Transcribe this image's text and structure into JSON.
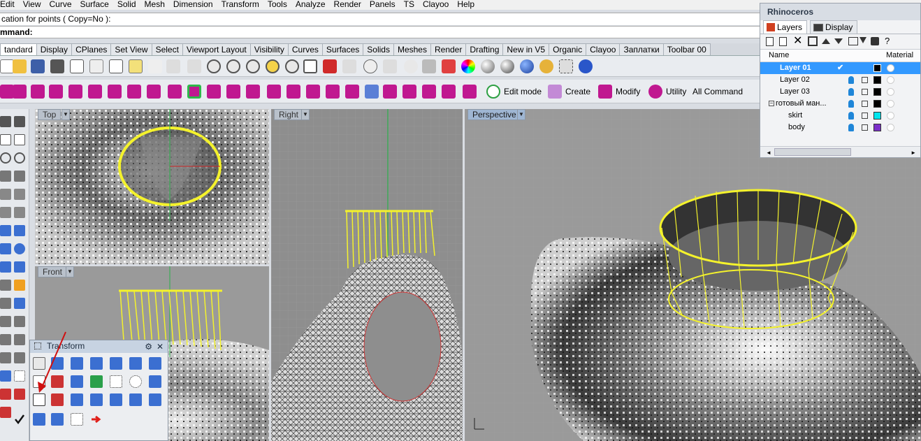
{
  "menubar": [
    "Edit",
    "View",
    "Curve",
    "Surface",
    "Solid",
    "Mesh",
    "Dimension",
    "Transform",
    "Tools",
    "Analyze",
    "Render",
    "Panels",
    "TS",
    "Clayoo",
    "Help"
  ],
  "command_history": "cation for points ( Copy=No ):",
  "command_prompt": "mmand:",
  "tabs": [
    "tandard",
    "Display",
    "CPlanes",
    "Set View",
    "Select",
    "Viewport Layout",
    "Visibility",
    "Curves",
    "Surfaces",
    "Solids",
    "Meshes",
    "Render",
    "Drafting",
    "New in V5",
    "Organic",
    "Clayoo",
    "Заплатки",
    "Toolbar 00"
  ],
  "toolbar2_labels": {
    "edit_mode": "Edit mode",
    "create": "Create",
    "modify": "Modify",
    "utility": "Utility",
    "all_command": "All Command"
  },
  "viewports": {
    "top": "Top",
    "front": "Front",
    "right": "Right",
    "perspective": "Perspective"
  },
  "layers_panel": {
    "title": "Rhinoceros",
    "tabs": [
      "Layers",
      "Display"
    ],
    "headers": {
      "name": "Name",
      "material": "Material"
    },
    "rows": [
      {
        "name": "Layer 01",
        "color": "#000000",
        "selected": true
      },
      {
        "name": "Layer 02",
        "color": "#000000",
        "selected": false
      },
      {
        "name": "Layer 03",
        "color": "#000000",
        "selected": false
      },
      {
        "name": "готовый ман...",
        "color": "#000000",
        "selected": false
      },
      {
        "name": "skirt",
        "color": "#00e5ee",
        "selected": false
      },
      {
        "name": "body",
        "color": "#7b2fc9",
        "selected": false
      }
    ]
  },
  "transform_panel": {
    "title": "Transform"
  }
}
